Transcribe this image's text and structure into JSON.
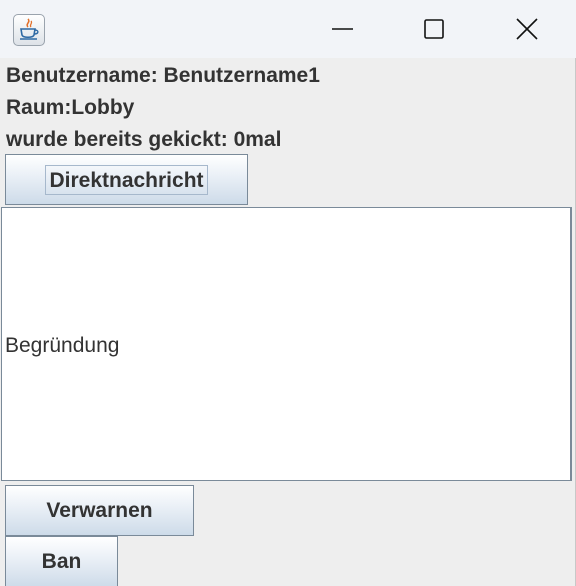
{
  "window": {
    "icon": "java-coffee-cup-icon",
    "controls": [
      "minimize-icon",
      "maximize-icon",
      "close-icon"
    ]
  },
  "info": {
    "username_line": "Benutzername: Benutzername1",
    "room_line": "Raum:Lobby",
    "kicks_line": "wurde bereits gekickt: 0mal"
  },
  "buttons": {
    "direct_message": "Direktnachricht",
    "warn": "Verwarnen",
    "ban": "Ban"
  },
  "reason": {
    "value": "Begründung"
  },
  "colors": {
    "background": "#eeeeee",
    "titlebar": "#f2f4f8",
    "text": "#333333",
    "button_border": "#7a8a99"
  }
}
